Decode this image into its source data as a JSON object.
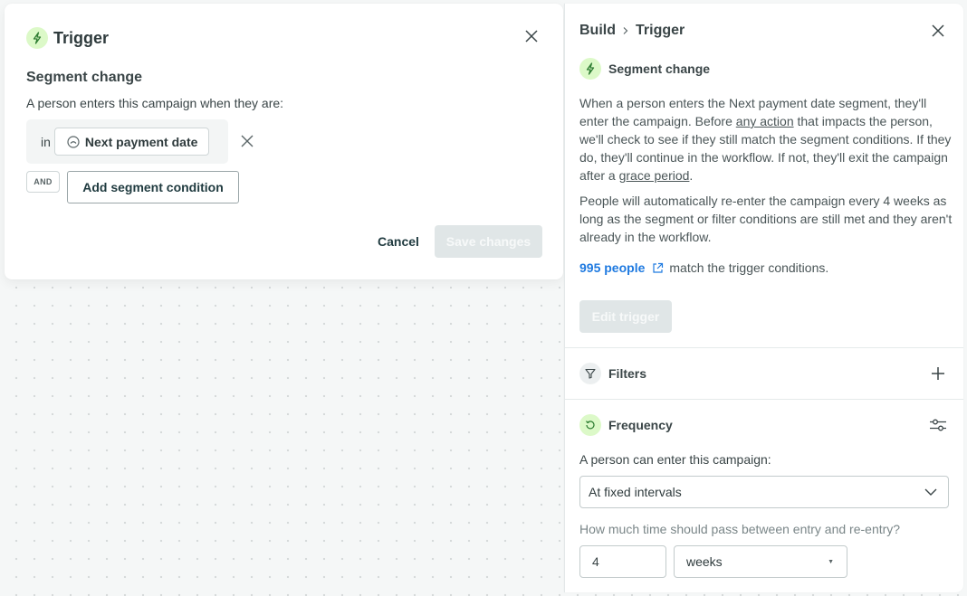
{
  "trigger_modal": {
    "title": "Trigger",
    "title_icon": "lightning-bolt-icon",
    "subtitle": "Segment change",
    "description": "A person enters this campaign when they are:",
    "condition": {
      "prefix": "in",
      "segment_icon": "segment-icon",
      "segment_name": "Next payment date"
    },
    "and_label": "AND",
    "add_condition_label": "Add segment condition",
    "cancel_label": "Cancel",
    "save_label": "Save changes"
  },
  "side_panel": {
    "breadcrumb": [
      "Build",
      "Trigger"
    ],
    "trigger_type": "Segment change",
    "paragraph1": {
      "part1": "When a person enters the Next payment date segment, they'll enter the campaign. Before ",
      "link1": "any action",
      "part2": " that impacts the person, we'll check to see if they still match the segment conditions. If they do, they'll continue in the workflow. If not, they'll exit the campaign after a ",
      "link2": "grace period",
      "part3": "."
    },
    "paragraph2": "People will automatically re-enter the campaign every 4 weeks as long as the segment or filter conditions are still met and they aren't already in the workflow.",
    "people_count_link": "995 people",
    "people_suffix": "match the trigger conditions.",
    "edit_trigger_label": "Edit trigger",
    "filters_label": "Filters",
    "frequency": {
      "label": "Frequency",
      "entry_label": "A person can enter this campaign:",
      "entry_value": "At fixed intervals",
      "interval_question": "How much time should pass between entry and re-entry?",
      "interval_value": "4",
      "interval_unit": "weeks"
    }
  },
  "colors": {
    "accent_green_bg": "#dcf9c8",
    "accent_green": "#2e7d32",
    "link_blue": "#1f7ae0",
    "disabled_button": "#e0e6e7"
  }
}
